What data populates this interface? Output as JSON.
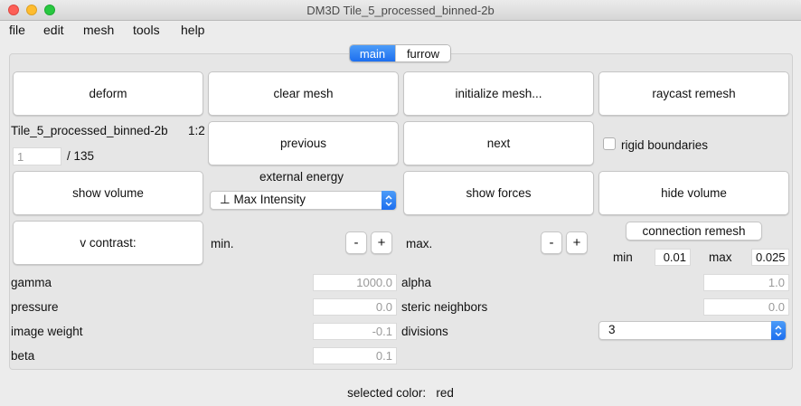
{
  "window": {
    "title": "DM3D Tile_5_processed_binned-2b"
  },
  "menus": [
    "file",
    "edit",
    "mesh",
    "tools",
    "help"
  ],
  "tabs": {
    "main": "main",
    "furrow": "furrow"
  },
  "buttons": {
    "deform": "deform",
    "clear_mesh": "clear mesh",
    "initialize_mesh": "initialize mesh...",
    "raycast_remesh": "raycast remesh",
    "previous": "previous",
    "next": "next",
    "show_volume": "show volume",
    "show_forces": "show forces",
    "hide_volume": "hide volume",
    "v_contrast": "v contrast:",
    "connection_remesh": "connection remesh",
    "min_minus": "-",
    "min_plus": "+",
    "max_minus": "-",
    "max_plus": "+"
  },
  "image": {
    "name": "Tile_5_processed_binned-2b",
    "scale": "1:2",
    "frame": "1",
    "frame_total": "/ 135"
  },
  "rigid_boundaries": {
    "label": "rigid boundaries",
    "checked": false
  },
  "external_energy": {
    "label": "external energy",
    "selected": "⊥ Max Intensity"
  },
  "contrast": {
    "min_label": "min.",
    "max_label": "max."
  },
  "remesh": {
    "min_label": "min",
    "min_value": "0.01",
    "max_label": "max",
    "max_value": "0.025"
  },
  "params_left": [
    {
      "label": "gamma",
      "value": "1000.0"
    },
    {
      "label": "pressure",
      "value": "0.0"
    },
    {
      "label": "image weight",
      "value": "-0.1"
    },
    {
      "label": "beta",
      "value": "0.1"
    }
  ],
  "params_right": {
    "alpha": {
      "label": "alpha",
      "value": "1.0"
    },
    "steric": {
      "label": "steric neighbors",
      "value": "0.0"
    },
    "divisions": {
      "label": "divisions",
      "selected": "3"
    }
  },
  "status": {
    "label": "selected color:",
    "value": "red"
  },
  "colors": {
    "accent": "#1d6fef",
    "close": "#fd5f57",
    "minimize": "#febc2e",
    "zoom": "#28c840"
  }
}
